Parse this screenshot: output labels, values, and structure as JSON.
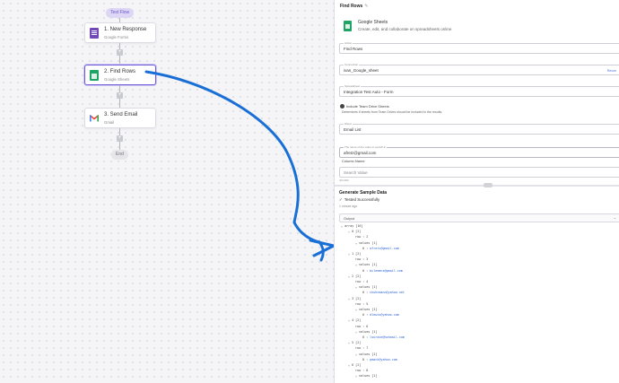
{
  "canvas": {
    "test_flow_label": "Test Flow",
    "steps": [
      {
        "title": "1. New Response",
        "app": "Google Forms",
        "icon": "google-forms-icon"
      },
      {
        "title": "2. Find Rows",
        "app": "Google Sheets",
        "icon": "google-sheets-icon"
      },
      {
        "title": "3. Send Email",
        "app": "Gmail",
        "icon": "gmail-icon"
      }
    ],
    "end_label": "End",
    "colors": {
      "accent": "#6e5bd8",
      "arrow": "#1a6fd6",
      "sheets": "#1fa463",
      "forms": "#7248b9"
    }
  },
  "panel": {
    "title": "Find Rows",
    "edit_icon": "pencil-icon",
    "app_name": "Google Sheets",
    "app_desc": "Create, edit, and collaborate on spreadsheets online",
    "fields": {
      "action": {
        "label": "Action",
        "value": "Find Rows"
      },
      "connection": {
        "label": "Connection",
        "value": "ivan_Google_sheet",
        "side": "Recon"
      },
      "spreadsheet": {
        "label": "Spreadsheet",
        "value": "Integration Test Auto - Form"
      },
      "sheet": {
        "label": "Sheet",
        "value": "Email List"
      },
      "search_value": {
        "label": "The name of the value to search in",
        "value": "afretz@gmail.com"
      },
      "column_name": {
        "label": "",
        "value": "Column Name"
      },
      "search_placeholder": {
        "label": "",
        "value": "Search Value"
      }
    },
    "team_drive_label": "Include Team Drive Sheets",
    "team_drive_help": "Determines if sheets from Team Drives should be included in the results.",
    "counter": "40/1000",
    "generate_title": "Generate Sample Data",
    "tested_label": "Tested Successfully",
    "tested_time": "1 minute ago",
    "output_label": "Output",
    "tree": [
      {
        "t": "⌄ array [16]",
        "d": 0
      },
      {
        "t": "⌄ 0 [2]",
        "d": 1
      },
      {
        "t": "row : 2",
        "d": 2
      },
      {
        "t": "⌄ values [1]",
        "d": 2
      },
      {
        "t": "0 : ",
        "d": 3,
        "email": "afretz@gmail.com"
      },
      {
        "t": "⌄ 1 [2]",
        "d": 1
      },
      {
        "t": "row : 3",
        "d": 2
      },
      {
        "t": "⌄ values [1]",
        "d": 2
      },
      {
        "t": "0 : ",
        "d": 3,
        "email": "bclemens@gmail.com"
      },
      {
        "t": "⌄ 2 [2]",
        "d": 1
      },
      {
        "t": "row : 4",
        "d": 2
      },
      {
        "t": "⌄ values [1]",
        "d": 2
      },
      {
        "t": "0 : ",
        "d": 3,
        "email": "ckuhnmann@yahoo.net"
      },
      {
        "t": "⌄ 3 [2]",
        "d": 1
      },
      {
        "t": "row : 5",
        "d": 2
      },
      {
        "t": "⌄ values [1]",
        "d": 2
      },
      {
        "t": "0 : ",
        "d": 3,
        "email": "dlewis@yahoo.com"
      },
      {
        "t": "⌄ 4 [2]",
        "d": 1
      },
      {
        "t": "row : 6",
        "d": 2
      },
      {
        "t": "⌄ values [1]",
        "d": 2
      },
      {
        "t": "0 : ",
        "d": 3,
        "email": "lsurace@hotmail.com"
      },
      {
        "t": "⌄ 5 [2]",
        "d": 1
      },
      {
        "t": "row : 7",
        "d": 2
      },
      {
        "t": "⌄ values [1]",
        "d": 2
      },
      {
        "t": "0 : ",
        "d": 3,
        "email": "gmack@yahoo.com"
      },
      {
        "t": "⌄ 6 [2]",
        "d": 1
      },
      {
        "t": "row : 8",
        "d": 2
      },
      {
        "t": "⌄ values [1]",
        "d": 2
      }
    ]
  }
}
